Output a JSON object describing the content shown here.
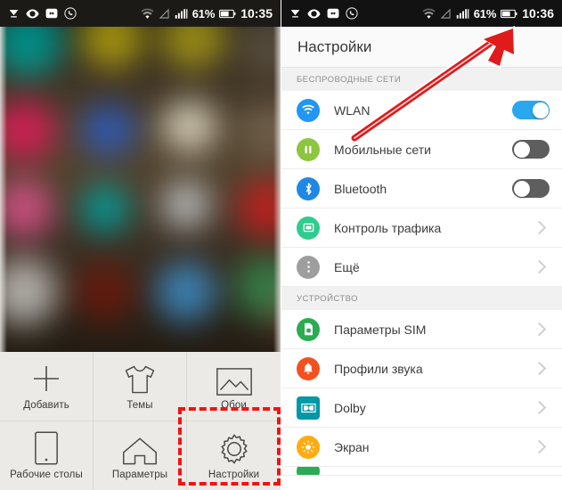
{
  "left_phone": {
    "statusbar": {
      "icons": [
        "download-icon",
        "eye-icon",
        "data-transfer-icon",
        "viber-icon",
        "wifi-icon",
        "signal-triangle-icon",
        "signal-bars-icon"
      ],
      "battery_percent": "61%",
      "clock": "10:35"
    },
    "home_screen": {
      "description": "blurred-home-screen-wallpaper"
    },
    "dock": {
      "items": [
        {
          "label": "Добавить",
          "icon": "plus-icon"
        },
        {
          "label": "Темы",
          "icon": "tshirt-icon"
        },
        {
          "label": "Обои",
          "icon": "picture-icon"
        },
        {
          "label": "Рабочие столы",
          "icon": "phone-icon"
        },
        {
          "label": "Параметры",
          "icon": "home-icon"
        },
        {
          "label": "Настройки",
          "icon": "gear-icon"
        }
      ],
      "highlighted_item": "Настройки"
    }
  },
  "right_phone": {
    "statusbar": {
      "icons": [
        "download-icon",
        "eye-icon",
        "data-transfer-icon",
        "viber-icon",
        "wifi-icon",
        "signal-triangle-icon",
        "signal-bars-icon"
      ],
      "battery_percent": "61%",
      "clock": "10:36"
    },
    "title": "Настройки",
    "sections": [
      {
        "header": "БЕСПРОВОДНЫЕ СЕТИ",
        "rows": [
          {
            "label": "WLAN",
            "icon": "wifi-icon",
            "icon_color": "#2196f3",
            "control": "toggle",
            "toggle_state": "on"
          },
          {
            "label": "Мобильные сети",
            "icon": "mobile-network-icon",
            "icon_color": "#8cc63e",
            "control": "toggle",
            "toggle_state": "off"
          },
          {
            "label": "Bluetooth",
            "icon": "bluetooth-icon",
            "icon_color": "#1e88e5",
            "control": "toggle",
            "toggle_state": "off"
          },
          {
            "label": "Контроль трафика",
            "icon": "traffic-control-icon",
            "icon_color": "#2ecc8f",
            "control": "chevron"
          },
          {
            "label": "Ещё",
            "icon": "more-dots-icon",
            "icon_color": "#9e9e9e",
            "control": "chevron"
          }
        ]
      },
      {
        "header": "УСТРОЙСТВО",
        "rows": [
          {
            "label": "Параметры SIM",
            "icon": "sim-card-icon",
            "icon_color": "#2bab52",
            "control": "chevron"
          },
          {
            "label": "Профили звука",
            "icon": "bell-icon",
            "icon_color": "#f4511e",
            "control": "chevron"
          },
          {
            "label": "Dolby",
            "icon": "dolby-icon",
            "icon_color": "#0097a7",
            "control": "chevron",
            "icon_shape": "square"
          },
          {
            "label": "Экран",
            "icon": "brightness-icon",
            "icon_color": "#ffab10",
            "control": "chevron"
          }
        ]
      }
    ],
    "annotation": {
      "type": "red-arrow",
      "color": "#e01b1b",
      "points_to": "Мобильные сети"
    }
  },
  "colors": {
    "accent_blue": "#29a8f0",
    "annotation_red": "#e01b1b",
    "toggle_off_gray": "#5e5e5e"
  }
}
